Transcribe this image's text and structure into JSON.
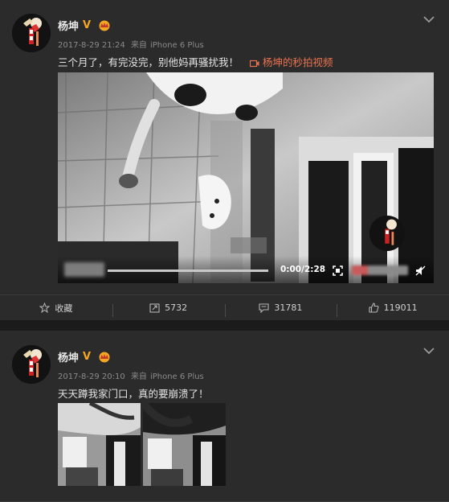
{
  "posts": [
    {
      "author": "杨坤",
      "verified_badge": "V",
      "date": "2017-8-29 21:24",
      "source_prefix": "来自",
      "device": "iPhone 6 Plus",
      "text": "三个月了，有完没完，别他妈再骚扰我！",
      "video_link": "杨坤的秒拍视频",
      "video": {
        "timecode": "0:00/2:28",
        "progress_fraction": 0.0
      },
      "actions": {
        "favorite": "收藏",
        "repost": "5732",
        "comment": "31781",
        "like": "119011"
      }
    },
    {
      "author": "杨坤",
      "verified_badge": "V",
      "date": "2017-8-29 20:10",
      "source_prefix": "来自",
      "device": "iPhone 6 Plus",
      "text": "天天蹲我家门口，真的要崩溃了！",
      "images_count_shown": 2
    }
  ],
  "icons": {
    "avatar": "avatar-icon",
    "verified": "verified-v-icon",
    "vip": "vip-crown-icon",
    "menu": "chevron-down-icon",
    "video_link": "video-camera-icon",
    "favorite": "star-icon",
    "repost": "repost-icon",
    "comment": "comment-icon",
    "like": "thumbs-up-icon",
    "fullscreen": "fullscreen-icon",
    "mute": "mute-icon"
  },
  "colors": {
    "background": "#1e1e1e",
    "card": "#2b2b2b",
    "accent_link": "#eb7350",
    "verified": "#f5a623"
  }
}
